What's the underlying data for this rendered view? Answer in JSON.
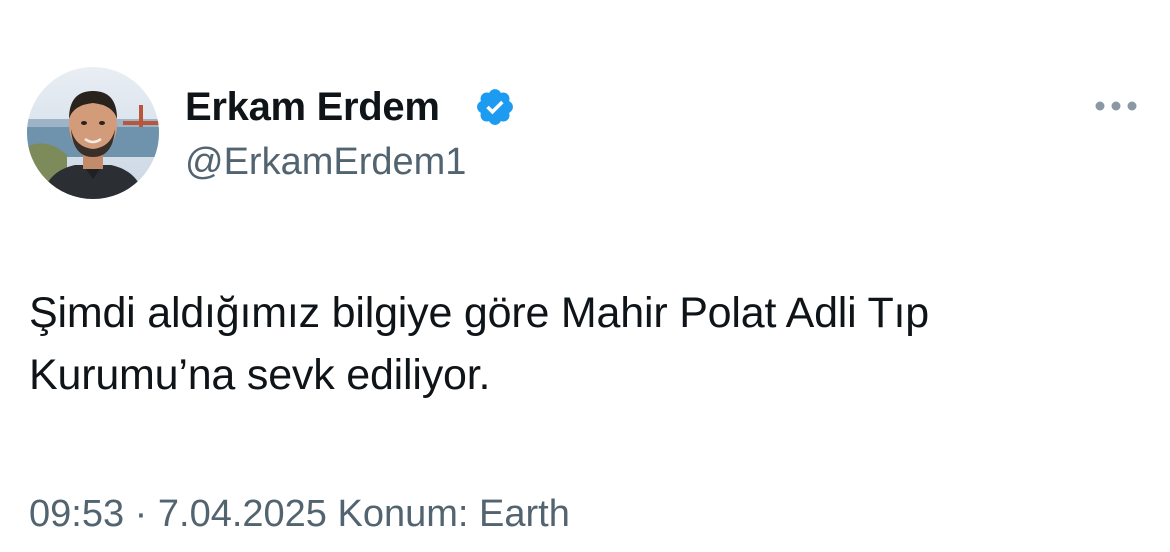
{
  "author": {
    "display_name": "Erkam Erdem",
    "handle": "@ErkamErdem1",
    "verified_icon": "verified-badge-icon",
    "avatar_icon": "profile-photo"
  },
  "tweet": {
    "text_line1": "Şimdi aldığımız bilgiye göre Mahir Polat Adli Tıp",
    "text_line2": "Kurumu’na sevk ediliyor."
  },
  "meta": {
    "time": "09:53",
    "separator": "·",
    "date": "7.04.2025",
    "location": "Konum: Earth"
  },
  "more_icon": "more-dots-icon",
  "colors": {
    "verified": "#1d9bf0",
    "secondary_text": "#536471",
    "primary_text": "#0f1419"
  }
}
